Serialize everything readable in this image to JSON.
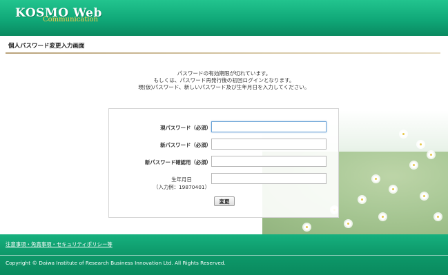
{
  "header": {
    "logo_main": "KOSMO Web",
    "logo_sub": "Communication"
  },
  "page": {
    "title": "個人パスワード変更入力画面"
  },
  "message": {
    "line1": "パスワードの有効期限が切れています。",
    "line2": "もしくは、パスワード再発行後の初回ログインとなります。",
    "line3": "現(仮)パスワード、新しいパスワード及び生年月日を入力してください。"
  },
  "form": {
    "current_password_label": "現パスワード（必須）",
    "current_password_value": "",
    "new_password_label": "新パスワード（必須）",
    "new_password_value": "",
    "confirm_password_label": "新パスワード確認用（必須）",
    "confirm_password_value": "",
    "birthdate_label": "生年月日",
    "birthdate_example": "（入力例：19870401）",
    "birthdate_value": "",
    "submit_label": "変更"
  },
  "footer": {
    "links_label": "注意事項・免責事項・セキュリティポリシー等",
    "copyright": "Copyright © Daiwa Institute of Research Business Innovation Ltd. All Rights Reserved."
  },
  "colors": {
    "brand_green": "#10a878",
    "logo_gold": "#f2c94c",
    "title_rule": "#b9a27a"
  }
}
